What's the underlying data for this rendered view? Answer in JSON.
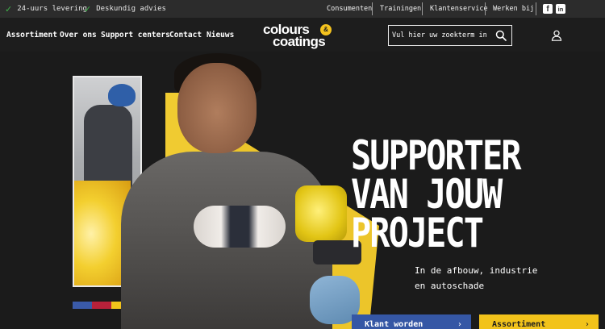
{
  "topbar": {
    "usps": [
      "24-uurs levering",
      "Deskundig advies"
    ],
    "links": [
      "Consumenten",
      "Trainingen",
      "Klantenservice",
      "Werken bij"
    ],
    "social": [
      {
        "name": "facebook",
        "glyph": "f"
      },
      {
        "name": "linkedin",
        "glyph": "in"
      }
    ]
  },
  "nav": {
    "items": [
      "Assortiment",
      "Over ons",
      "Support centers",
      "Contact",
      "Nieuws"
    ]
  },
  "logo": {
    "line1": "colours",
    "line2": "coatings",
    "amp": "&"
  },
  "search": {
    "placeholder": "Vul hier uw zoekterm in"
  },
  "hero": {
    "headline": [
      "SUPPORTER",
      "VAN JOUW",
      "PROJECT"
    ],
    "subtitle": [
      "In de afbouw, industrie",
      "en autoschade"
    ],
    "buttons": [
      {
        "label": "Klant worden",
        "chevron": "›"
      },
      {
        "label": "Assortiment",
        "chevron": "›"
      }
    ],
    "stripe_colors": [
      "#3a5aa8",
      "#b7213a",
      "#f2c31b"
    ]
  },
  "colors": {
    "accent_yellow": "#f2c31b",
    "button_blue": "#3557a5",
    "check_green": "#3fb24a"
  }
}
